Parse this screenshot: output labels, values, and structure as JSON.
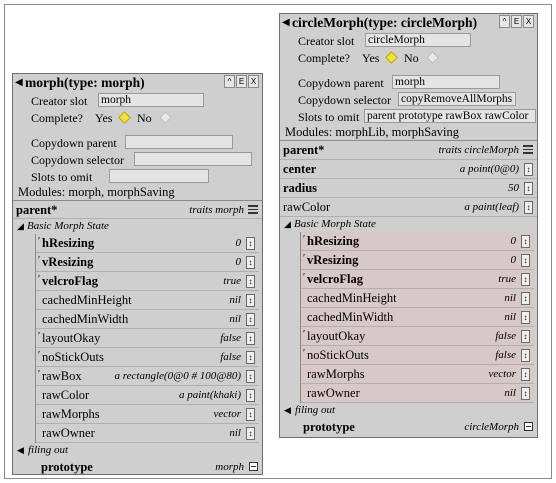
{
  "morph": {
    "title": "morph(type: morph)",
    "buttons": [
      "^",
      "E",
      "X"
    ],
    "creator_slot_label": "Creator slot",
    "creator_slot_value": "morph",
    "complete_label": "Complete?",
    "yes_label": "Yes",
    "no_label": "No",
    "copydown_parent_label": "Copydown parent",
    "copydown_parent_value": "",
    "copydown_selector_label": "Copydown selector",
    "copydown_selector_value": "",
    "slots_to_omit_label": "Slots to omit",
    "slots_to_omit_value": "",
    "modules": "Modules:  morph, morphSaving",
    "parent_slot": {
      "name": "parent*",
      "value": "traits morph"
    },
    "category1": "Basic Morph State",
    "state_slots": [
      {
        "name": "hResizing",
        "value": "0",
        "bold": true,
        "tick": true
      },
      {
        "name": "vResizing",
        "value": "0",
        "bold": true,
        "tick": true
      },
      {
        "name": "velcroFlag",
        "value": "true",
        "bold": true,
        "tick": true
      },
      {
        "name": "cachedMinHeight",
        "value": "nil",
        "bold": false,
        "tick": false
      },
      {
        "name": "cachedMinWidth",
        "value": "nil",
        "bold": false,
        "tick": false
      },
      {
        "name": "layoutOkay",
        "value": "false",
        "bold": false,
        "tick": true
      },
      {
        "name": "noStickOuts",
        "value": "false",
        "bold": false,
        "tick": true
      },
      {
        "name": "rawBox",
        "value": "a rectangle(0@0 # 100@80)",
        "bold": false,
        "tick": true
      },
      {
        "name": "rawColor",
        "value": "a paint(khaki)",
        "bold": false,
        "tick": false
      },
      {
        "name": "rawMorphs",
        "value": "vector",
        "bold": false,
        "tick": false
      },
      {
        "name": "rawOwner",
        "value": "nil",
        "bold": false,
        "tick": false
      }
    ],
    "category2": "filing out",
    "prototype_slot": {
      "name": "prototype",
      "value": "morph"
    }
  },
  "circle": {
    "title": "circleMorph(type: circleMorph)",
    "buttons": [
      "^",
      "E",
      "X"
    ],
    "creator_slot_label": "Creator slot",
    "creator_slot_value": "circleMorph",
    "complete_label": "Complete?",
    "yes_label": "Yes",
    "no_label": "No",
    "copydown_parent_label": "Copydown parent",
    "copydown_parent_value": "morph",
    "copydown_selector_label": "Copydown selector",
    "copydown_selector_value": "copyRemoveAllMorphs",
    "slots_to_omit_label": "Slots to omit",
    "slots_to_omit_value": "parent prototype rawBox rawColor",
    "modules": "Modules:  morphLib, morphSaving",
    "top_slots": [
      {
        "name": "parent*",
        "value": "traits circleMorph",
        "bold": true,
        "btn": "eq"
      },
      {
        "name": "center",
        "value": "a point(0@0)",
        "bold": true,
        "btn": "arrow"
      },
      {
        "name": "radius",
        "value": "50",
        "bold": true,
        "btn": "arrow"
      },
      {
        "name": "rawColor",
        "value": "a paint(leaf)",
        "bold": false,
        "btn": "arrow"
      }
    ],
    "category1": "Basic Morph State",
    "state_slots": [
      {
        "name": "hResizing",
        "value": "0",
        "bold": true,
        "tick": true
      },
      {
        "name": "vResizing",
        "value": "0",
        "bold": true,
        "tick": true
      },
      {
        "name": "velcroFlag",
        "value": "true",
        "bold": true,
        "tick": true
      },
      {
        "name": "cachedMinHeight",
        "value": "nil",
        "bold": false,
        "tick": false
      },
      {
        "name": "cachedMinWidth",
        "value": "nil",
        "bold": false,
        "tick": false
      },
      {
        "name": "layoutOkay",
        "value": "false",
        "bold": false,
        "tick": true
      },
      {
        "name": "noStickOuts",
        "value": "false",
        "bold": false,
        "tick": true
      },
      {
        "name": "rawMorphs",
        "value": "vector",
        "bold": false,
        "tick": false
      },
      {
        "name": "rawOwner",
        "value": "nil",
        "bold": false,
        "tick": false
      }
    ],
    "category2": "filing out",
    "prototype_slot": {
      "name": "prototype",
      "value": "circleMorph"
    }
  },
  "icons": {
    "collapse": "triangle-left-icon",
    "expand": "triangle-down-icon",
    "yes_selected": "yellow-diamond-icon",
    "no_unselected": "grey-diamond-icon",
    "slot_menu": "up-arrow-button-icon"
  },
  "colors": {
    "outliner_bg": "#cfcfcf",
    "inner_pink": "#d9c8c8",
    "yes_diamond": "#f4e23c"
  }
}
